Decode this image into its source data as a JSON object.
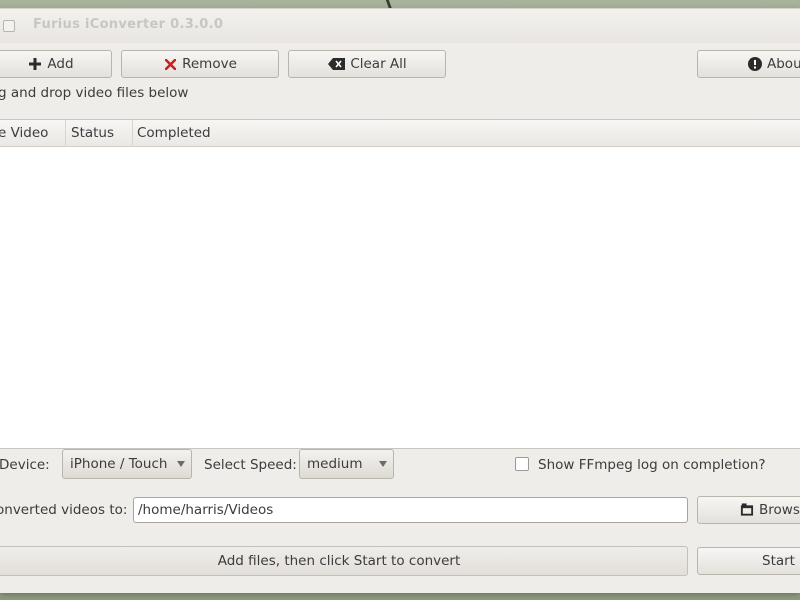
{
  "window": {
    "title": "Furius iConverter 0.3.0.0"
  },
  "toolbar": {
    "add_label": "Add",
    "remove_label": "Remove",
    "clear_all_label": "Clear All",
    "about_label": "About"
  },
  "drag_hint": "g and drop video files below",
  "file_list": {
    "columns": [
      "e Video",
      "Status",
      "Completed"
    ],
    "rows": []
  },
  "options": {
    "device_label": "Device:",
    "device_value": "iPhone / Touch",
    "speed_label": "Select Speed:",
    "speed_value": "medium",
    "ffmpeg_log_label": "Show FFmpeg log on completion?",
    "ffmpeg_log_checked": false
  },
  "output": {
    "label": "onverted videos to:",
    "path": "/home/harris/Videos",
    "browse_label": "Browse"
  },
  "footer": {
    "status_text": "Add files, then click Start to convert",
    "start_label": "Start"
  },
  "colors": {
    "remove_icon": "#cc1f1f",
    "window_bg": "#efedea"
  }
}
